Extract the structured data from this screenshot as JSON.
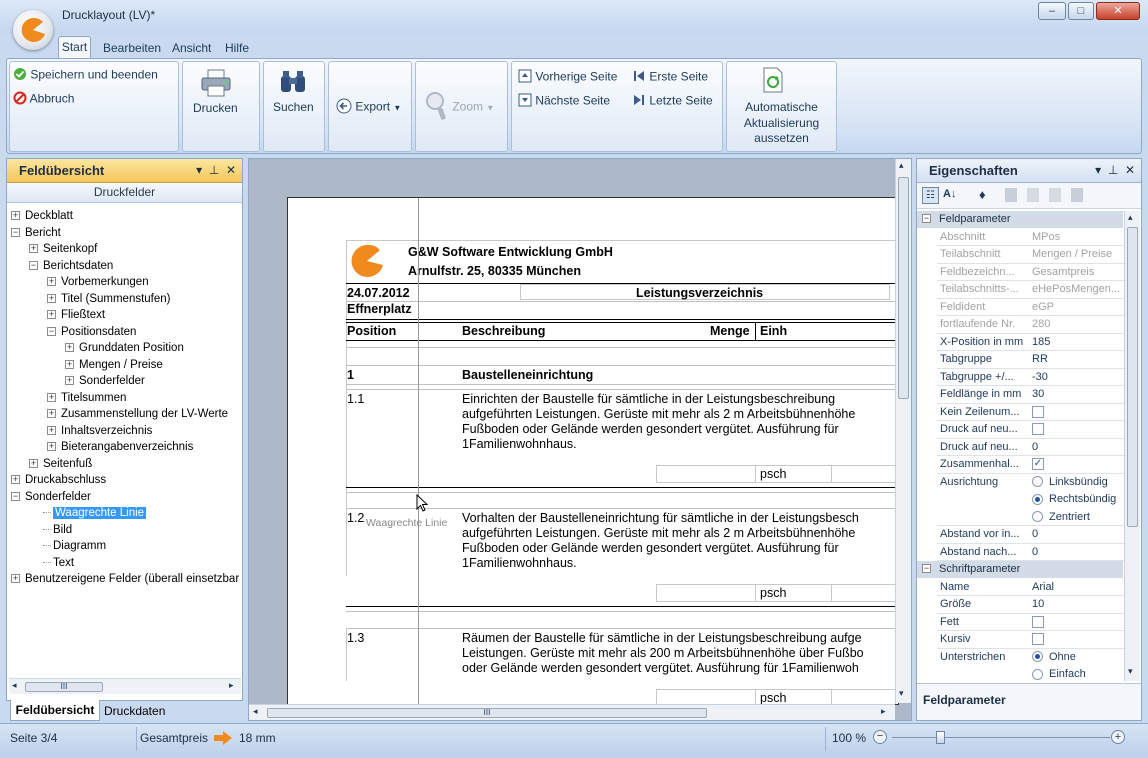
{
  "window": {
    "title": "Drucklayout (LV)*",
    "minimize": "–",
    "maximize": "□",
    "close": "✕"
  },
  "menu": {
    "tabs": [
      "Start",
      "Bearbeiten",
      "Ansicht",
      "Hilfe"
    ]
  },
  "ribbon": {
    "save_label": "Speichern und beenden",
    "cancel_label": "Abbruch",
    "print_label": "Drucken",
    "search_label": "Suchen",
    "export_label": "Export",
    "zoom_label": "Zoom",
    "prev_page": "Vorherige Seite",
    "next_page": "Nächste Seite",
    "first_page": "Erste Seite",
    "last_page": "Letzte Seite",
    "auto_update": [
      "Automatische",
      "Aktualisierung",
      "aussetzen"
    ]
  },
  "left_panel": {
    "title": "Feldübersicht",
    "subheader": "Druckfelder",
    "tree": [
      {
        "label": "Deckblatt",
        "level": 0,
        "toggle": "+"
      },
      {
        "label": "Bericht",
        "level": 0,
        "toggle": "−"
      },
      {
        "label": "Seitenkopf",
        "level": 1,
        "toggle": "+"
      },
      {
        "label": "Berichtsdaten",
        "level": 1,
        "toggle": "−"
      },
      {
        "label": "Vorbemerkungen",
        "level": 2,
        "toggle": "+"
      },
      {
        "label": "Titel (Summenstufen)",
        "level": 2,
        "toggle": "+"
      },
      {
        "label": "Fließtext",
        "level": 2,
        "toggle": "+"
      },
      {
        "label": "Positionsdaten",
        "level": 2,
        "toggle": "−"
      },
      {
        "label": "Grunddaten Position",
        "level": 3,
        "toggle": "+"
      },
      {
        "label": "Mengen / Preise",
        "level": 3,
        "toggle": "+"
      },
      {
        "label": "Sonderfelder",
        "level": 3,
        "toggle": "+"
      },
      {
        "label": "Titelsummen",
        "level": 2,
        "toggle": "+"
      },
      {
        "label": "Zusammenstellung der LV-Werte",
        "level": 2,
        "toggle": "+"
      },
      {
        "label": "Inhaltsverzeichnis",
        "level": 2,
        "toggle": "+"
      },
      {
        "label": "Bieterangabenverzeichnis",
        "level": 2,
        "toggle": "+"
      },
      {
        "label": "Seitenfuß",
        "level": 1,
        "toggle": "+"
      },
      {
        "label": "Druckabschluss",
        "level": 0,
        "toggle": "+"
      },
      {
        "label": "Sonderfelder",
        "level": 0,
        "toggle": "−"
      },
      {
        "label": "Waagrechte Linie",
        "level": 1,
        "toggle": "",
        "selected": true
      },
      {
        "label": "Bild",
        "level": 1,
        "toggle": ""
      },
      {
        "label": "Diagramm",
        "level": 1,
        "toggle": ""
      },
      {
        "label": "Text",
        "level": 1,
        "toggle": ""
      },
      {
        "label": "Benutzereigene Felder (überall einsetzbar)",
        "level": 0,
        "toggle": "+"
      }
    ],
    "bottom_tabs": [
      "Feldübersicht",
      "Druckdaten"
    ],
    "scroll_grip": "III"
  },
  "document": {
    "company": "G&W Software Entwicklung GmbH",
    "address": "Arnulfstr. 25, 80335 München",
    "date": "24.07.2012",
    "doc_title": "Leistungsverzeichnis",
    "project": "Effnerplatz",
    "col_position": "Position",
    "col_desc": "Beschreibung",
    "col_qty": "Menge",
    "col_unit": "Einh",
    "section_no": "1",
    "section_title": "Baustelleneinrichtung",
    "drag_label": "Waagrechte Linie",
    "items": [
      {
        "no": "1.1",
        "lines": [
          "Einrichten der Baustelle für sämtliche in der Leistungsbeschreibung",
          "aufgeführten Leistungen. Gerüste mit mehr als 2 m Arbeitsbühnenhöhe",
          "Fußboden oder Gelände werden gesondert vergütet. Ausführung für",
          "1Familienwohnhaus."
        ],
        "unit": "psch"
      },
      {
        "no": "1.2",
        "lines": [
          "Vorhalten der Baustelleneinrichtung für sämtliche in der Leistungsbesch",
          "aufgeführten Leistungen. Gerüste mit mehr als 2 m Arbeitsbühnenhöhe",
          "Fußboden oder Gelände werden gesondert vergütet. Ausführung für",
          "1Familienwohnhaus."
        ],
        "unit": "psch"
      },
      {
        "no": "1.3",
        "lines": [
          "Räumen der Baustelle für sämtliche in der Leistungsbeschreibung aufge",
          "Leistungen. Gerüste mit mehr als 200 m Arbeitsbühnenhöhe über Fußbo",
          "oder Gelände werden gesondert vergütet. Ausführung für 1Familienwoh"
        ],
        "unit": "psch"
      }
    ],
    "hscroll_grip": "III"
  },
  "properties": {
    "title": "Eigenschaften",
    "cat1": "Feldparameter",
    "rows1": [
      {
        "key": "Abschnitt",
        "value": "MPos",
        "disabled": true
      },
      {
        "key": "Teilabschnitt",
        "value": "Mengen / Preise",
        "disabled": true
      },
      {
        "key": "Feldbezeichn...",
        "value": "Gesamtpreis",
        "disabled": true
      },
      {
        "key": "Teilabschnitts-...",
        "value": "eHePosMengen...",
        "disabled": true
      },
      {
        "key": "Feldident",
        "value": "eGP",
        "disabled": true
      },
      {
        "key": "fortlaufende Nr.",
        "value": "280",
        "disabled": true
      },
      {
        "key": "X-Position in mm",
        "value": "185"
      },
      {
        "key": "Tabgruppe",
        "value": "RR"
      },
      {
        "key": "Tabgruppe +/...",
        "value": "-30"
      },
      {
        "key": "Feldlänge in mm",
        "value": "30"
      },
      {
        "key": "Kein Zeilenum...",
        "value": "",
        "checkbox": false
      },
      {
        "key": "Druck auf neu...",
        "value": "",
        "checkbox": false
      },
      {
        "key": "Druck auf neu...",
        "value": "0"
      },
      {
        "key": "Zusammenhal...",
        "value": "",
        "checkbox": true
      }
    ],
    "ausrichtung_key": "Ausrichtung",
    "ausrichtung_options": [
      "Linksbündig",
      "Rechtsbündig",
      "Zentriert"
    ],
    "rows1b": [
      {
        "key": "Abstand vor in...",
        "value": "0"
      },
      {
        "key": "Abstand nach...",
        "value": "0"
      }
    ],
    "cat2": "Schriftparameter",
    "rows2": [
      {
        "key": "Name",
        "value": "Arial"
      },
      {
        "key": "Größe",
        "value": "10"
      },
      {
        "key": "Fett",
        "value": "",
        "checkbox": false
      },
      {
        "key": "Kursiv",
        "value": "",
        "checkbox": false
      }
    ],
    "underline_key": "Unterstrichen",
    "underline_options": [
      "Ohne",
      "Einfach"
    ],
    "footer": "Feldparameter"
  },
  "status": {
    "page": "Seite 3/4",
    "field": "Gesamtpreis",
    "position": "18 mm",
    "zoom": "100 %"
  }
}
